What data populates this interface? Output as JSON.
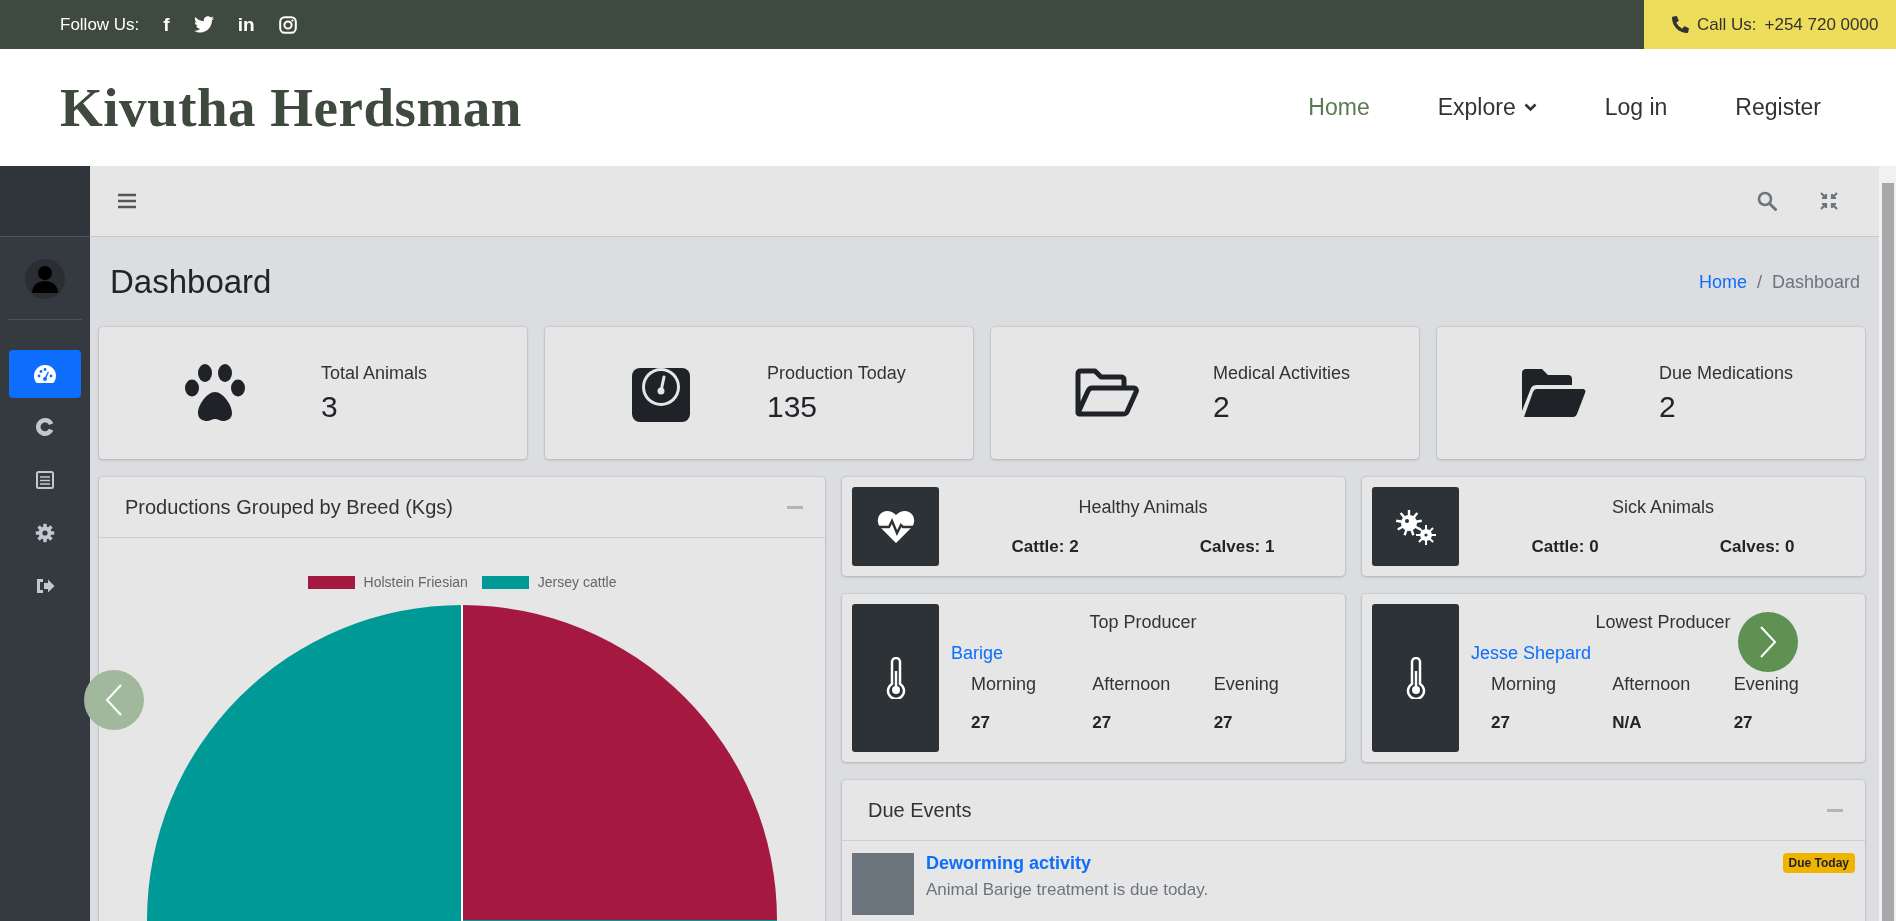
{
  "topbar": {
    "follow_label": "Follow Us:",
    "social": [
      {
        "kind": "text",
        "glyph": "f"
      },
      {
        "kind": "bird"
      },
      {
        "kind": "text",
        "glyph": "in"
      },
      {
        "kind": "camera"
      }
    ],
    "call_label": "Call Us:",
    "phone": "+254 720 0000"
  },
  "header": {
    "brand": "Kivutha Herdsman",
    "nav": [
      {
        "label": "Home",
        "selected": true,
        "dropdown": false
      },
      {
        "label": "Explore",
        "selected": false,
        "dropdown": true
      },
      {
        "label": "Log in",
        "selected": false,
        "dropdown": false
      },
      {
        "label": "Register",
        "selected": false,
        "dropdown": false
      }
    ]
  },
  "sidebar": {
    "items": [
      {
        "kind": "gauge",
        "selected": true
      },
      {
        "kind": "c-shape",
        "selected": false
      },
      {
        "kind": "list",
        "selected": false
      },
      {
        "kind": "gear",
        "selected": false
      },
      {
        "kind": "logout",
        "selected": false
      }
    ]
  },
  "page": {
    "title": "Dashboard",
    "separator": "/",
    "breadcrumb": [
      {
        "label": "Home",
        "selected": false
      },
      {
        "label": "Dashboard",
        "selected": true
      }
    ]
  },
  "stats": [
    {
      "kind": "paw",
      "label": "Total Animals",
      "value": "3"
    },
    {
      "kind": "scale",
      "label": "Production Today",
      "value": "135"
    },
    {
      "kind": "folder-outline",
      "label": "Medical Activities",
      "value": "2"
    },
    {
      "kind": "folder-solid",
      "label": "Due Medications",
      "value": "2"
    }
  ],
  "chart_card": {
    "title": "Productions Grouped by Breed (Kgs)",
    "legend": [
      {
        "label": "Holstein Friesian",
        "color": "#a51940"
      },
      {
        "label": "Jersey cattle",
        "color": "#009a96"
      }
    ]
  },
  "health": [
    {
      "kind": "heart",
      "title": "Healthy Animals",
      "cattle": "Cattle: 2",
      "calves": "Calves: 1"
    },
    {
      "kind": "germs",
      "title": "Sick Animals",
      "cattle": "Cattle: 0",
      "calves": "Calves: 0"
    }
  ],
  "producers": [
    {
      "title": "Top Producer",
      "name": "Barige",
      "columns": [
        {
          "label": "Morning",
          "value": "27"
        },
        {
          "label": "Afternoon",
          "value": "27"
        },
        {
          "label": "Evening",
          "value": "27"
        }
      ]
    },
    {
      "title": "Lowest Producer",
      "name": "Jesse Shepard",
      "columns": [
        {
          "label": "Morning",
          "value": "27"
        },
        {
          "label": "Afternoon",
          "value": "N/A"
        },
        {
          "label": "Evening",
          "value": "27"
        }
      ]
    }
  ],
  "due_events": {
    "title": "Due Events",
    "items": [
      {
        "title": "Deworming activity",
        "description": "Animal Barige treatment is due today.",
        "badge": "Due Today"
      }
    ]
  }
}
